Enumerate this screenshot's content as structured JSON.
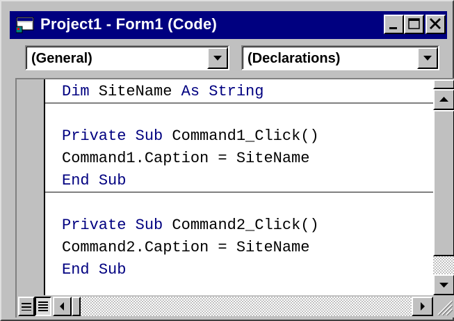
{
  "window": {
    "title": "Project1 - Form1 (Code)",
    "app_icon": "vb-form-icon",
    "controls": [
      "minimize-icon",
      "maximize-icon",
      "close-icon"
    ]
  },
  "object_combo": {
    "selected": "(General)"
  },
  "procedure_combo": {
    "selected": "(Declarations)"
  },
  "code": {
    "declarations": [
      {
        "parts": [
          {
            "t": "kw",
            "v": "Dim"
          },
          {
            "t": "tx",
            "v": " SiteName "
          },
          {
            "t": "kw",
            "v": "As"
          },
          {
            "t": "tx",
            "v": " "
          },
          {
            "t": "kw",
            "v": "String"
          }
        ]
      }
    ],
    "procedures": [
      [
        {
          "parts": [
            {
              "t": "kw",
              "v": "Private"
            },
            {
              "t": "tx",
              "v": " "
            },
            {
              "t": "kw",
              "v": "Sub"
            },
            {
              "t": "tx",
              "v": " Command1_Click()"
            }
          ]
        },
        {
          "parts": [
            {
              "t": "tx",
              "v": "Command1.Caption = SiteName"
            }
          ]
        },
        {
          "parts": [
            {
              "t": "kw",
              "v": "End"
            },
            {
              "t": "tx",
              "v": " "
            },
            {
              "t": "kw",
              "v": "Sub"
            }
          ]
        }
      ],
      [
        {
          "parts": [
            {
              "t": "kw",
              "v": "Private"
            },
            {
              "t": "tx",
              "v": " "
            },
            {
              "t": "kw",
              "v": "Sub"
            },
            {
              "t": "tx",
              "v": " Command2_Click()"
            }
          ]
        },
        {
          "parts": [
            {
              "t": "tx",
              "v": "Command2.Caption = SiteName"
            }
          ]
        },
        {
          "parts": [
            {
              "t": "kw",
              "v": "End"
            },
            {
              "t": "tx",
              "v": " "
            },
            {
              "t": "kw",
              "v": "Sub"
            }
          ]
        }
      ]
    ]
  },
  "colors": {
    "titlebar": "#000080",
    "keyword": "#000080",
    "text": "#000000",
    "face": "#c0c0c0"
  },
  "view_modes": {
    "procedure_view": "procedure-view-icon",
    "full_module_view": "full-module-view-icon",
    "active": "full_module_view"
  }
}
